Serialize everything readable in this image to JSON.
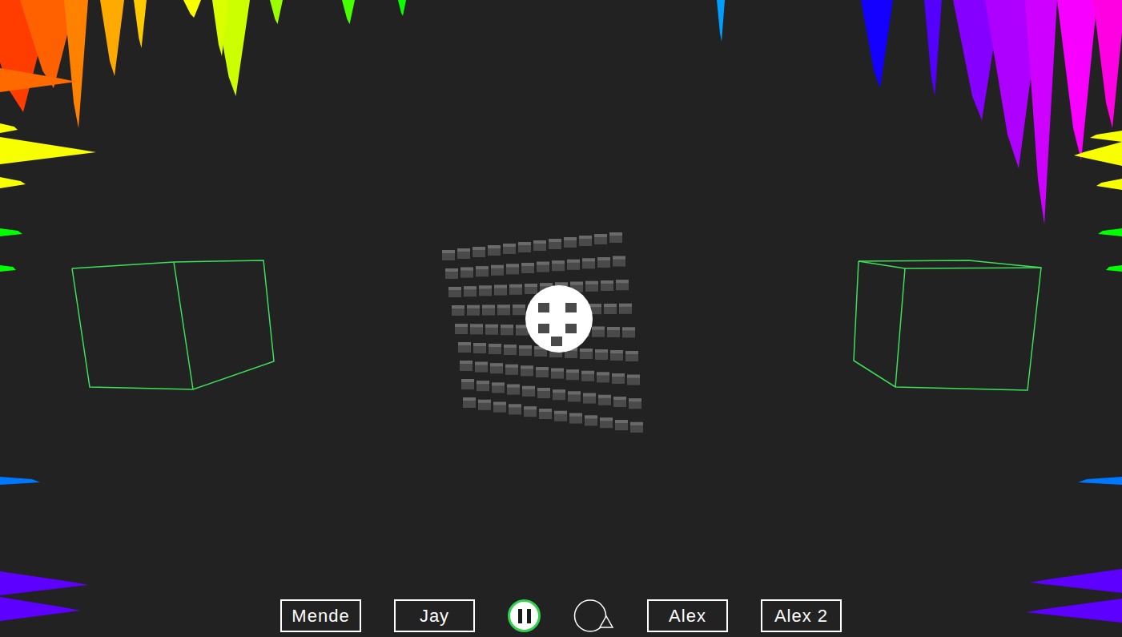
{
  "visualizer": {
    "playing": true
  },
  "controls": [
    {
      "kind": "text",
      "label": "Mende"
    },
    {
      "kind": "text",
      "label": "Jay"
    },
    {
      "kind": "pause"
    },
    {
      "kind": "cursor"
    },
    {
      "kind": "text",
      "label": "Alex"
    },
    {
      "kind": "text",
      "label": "Alex 2"
    }
  ]
}
